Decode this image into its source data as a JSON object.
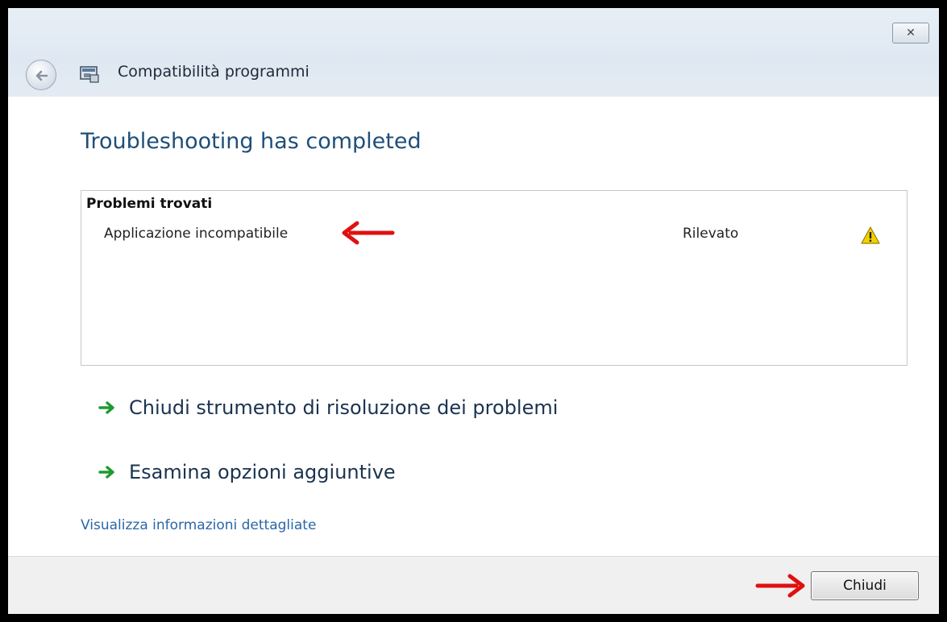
{
  "window": {
    "title": "Compatibilità programmi",
    "close_glyph": "✕"
  },
  "content": {
    "heading": "Troubleshooting has completed",
    "problems": {
      "header": "Problemi trovati",
      "items": [
        {
          "name": "Applicazione incompatibile",
          "status": "Rilevato",
          "icon": "warning-icon"
        }
      ]
    },
    "tasks": [
      {
        "label": "Chiudi strumento di risoluzione dei problemi",
        "icon": "green-arrow-icon"
      },
      {
        "label": "Esamina opzioni aggiuntive",
        "icon": "green-arrow-icon"
      }
    ],
    "details_link": "Visualizza informazioni dettagliate"
  },
  "footer": {
    "close_button": "Chiudi"
  },
  "colors": {
    "heading": "#1f4e79",
    "link": "#2a66a8",
    "annotation_arrow": "#e01010",
    "task_arrow": "#1f9a2e",
    "warning": "#f2d100"
  }
}
